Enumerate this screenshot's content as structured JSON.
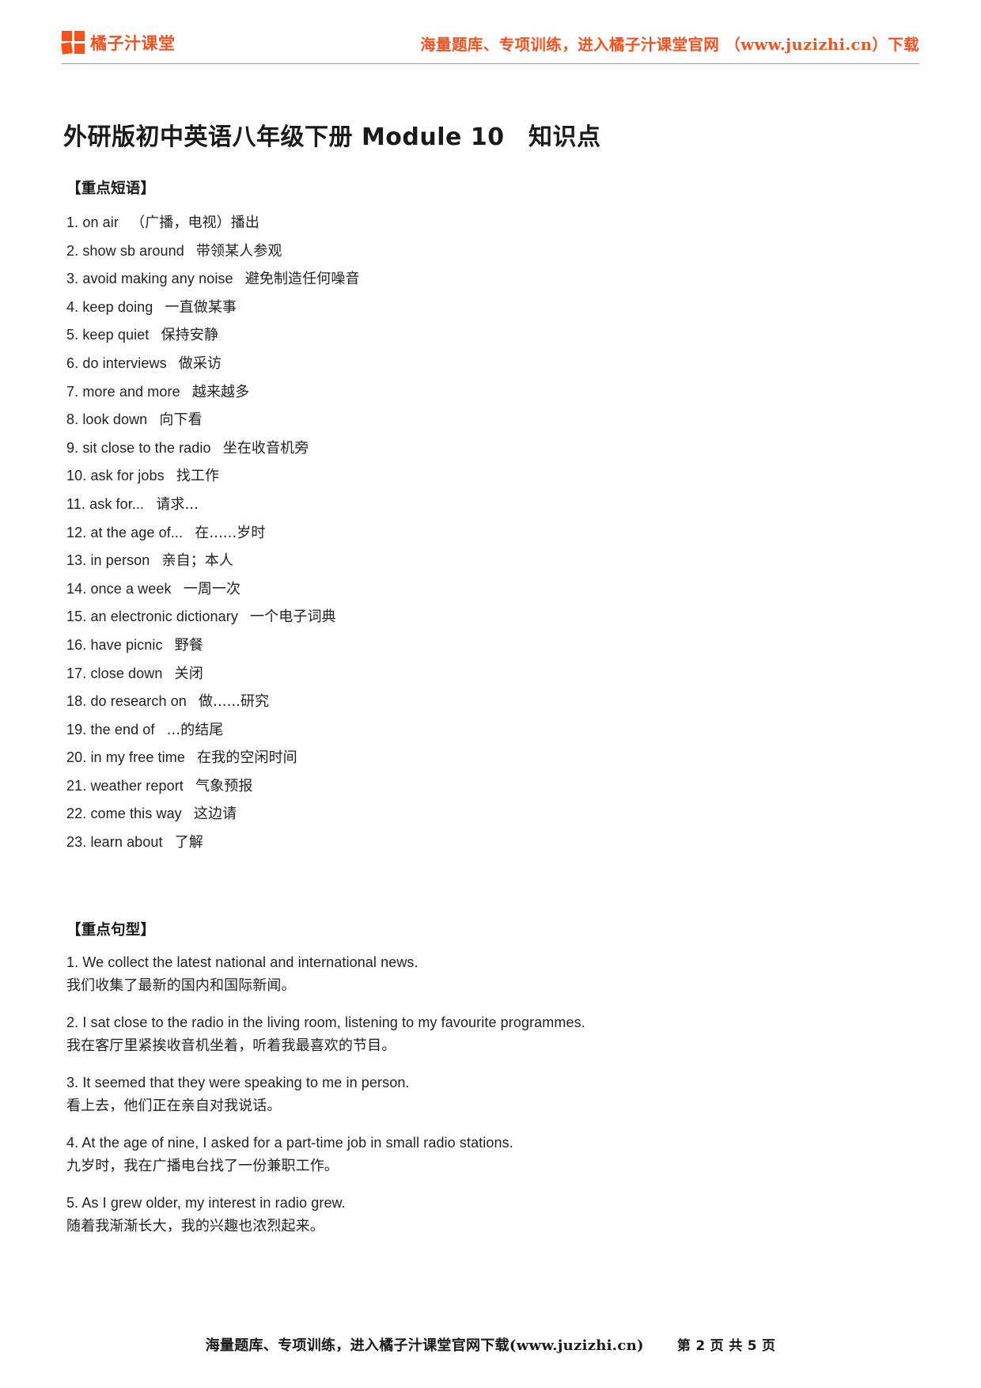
{
  "header": {
    "brand_name": "橘子汁课堂",
    "brand_color": "#f4511e",
    "promo": "海量题库、专项训练，进入橘子汁课堂官网 （www.juzizhi.cn）下载"
  },
  "title": "外研版初中英语八年级下册 Module 10　知识点",
  "phrases_section": {
    "heading": "【重点短语】",
    "items": [
      {
        "num": "1.",
        "en": "on air",
        "cn": "（广播，电视）播出"
      },
      {
        "num": "2.",
        "en": "show sb around",
        "cn": "带领某人参观"
      },
      {
        "num": "3.",
        "en": "avoid making any noise",
        "cn": "避免制造任何噪音"
      },
      {
        "num": "4.",
        "en": "keep doing",
        "cn": "一直做某事"
      },
      {
        "num": "5.",
        "en": "keep quiet",
        "cn": "保持安静"
      },
      {
        "num": "6.",
        "en": "do interviews",
        "cn": "做采访"
      },
      {
        "num": "7.",
        "en": "more and more",
        "cn": "越来越多"
      },
      {
        "num": "8.",
        "en": "look down",
        "cn": "向下看"
      },
      {
        "num": "9.",
        "en": "sit close to the radio",
        "cn": "坐在收音机旁"
      },
      {
        "num": "10.",
        "en": "ask for jobs",
        "cn": "找工作"
      },
      {
        "num": "11.",
        "en": "ask for...",
        "cn": "请求..."
      },
      {
        "num": "12.",
        "en": "at the age of...",
        "cn": "在......岁时"
      },
      {
        "num": "13.",
        "en": "in person",
        "cn": "亲自；本人"
      },
      {
        "num": "14.",
        "en": "once a week",
        "cn": "一周一次"
      },
      {
        "num": "15.",
        "en": "an electronic dictionary",
        "cn": "一个电子词典"
      },
      {
        "num": "16.",
        "en": "have picnic",
        "cn": "野餐"
      },
      {
        "num": "17.",
        "en": "close down",
        "cn": "关闭"
      },
      {
        "num": "18.",
        "en": "do research on",
        "cn": "做......研究"
      },
      {
        "num": "19.",
        "en": "the end of",
        "cn": "...的结尾"
      },
      {
        "num": "20.",
        "en": "in my free time",
        "cn": "在我的空闲时间"
      },
      {
        "num": "21.",
        "en": "weather report",
        "cn": "气象预报"
      },
      {
        "num": "22.",
        "en": "come this way",
        "cn": "这边请"
      },
      {
        "num": "23.",
        "en": "learn about",
        "cn": "了解"
      }
    ]
  },
  "sentences_section": {
    "heading": "【重点句型】",
    "items": [
      {
        "en": "1. We collect the latest national and international news.",
        "cn": "我们收集了最新的国内和国际新闻。"
      },
      {
        "en": "2. I sat close to the radio in the living room, listening to my favourite programmes.",
        "cn": "我在客厅里紧挨收音机坐着，听着我最喜欢的节目。"
      },
      {
        "en": "3. It seemed that they were speaking to me in person.",
        "cn": "看上去，他们正在亲自对我说话。"
      },
      {
        "en": "4. At the age of nine, I asked for a part-time job in small radio stations.",
        "cn": "九岁时，我在广播电台找了一份兼职工作。"
      },
      {
        "en": "5. As I grew older, my interest in radio grew.",
        "cn": "随着我渐渐长大，我的兴趣也浓烈起来。"
      }
    ]
  },
  "footer": {
    "promo": "海量题库、专项训练，进入橘子汁课堂官网下载(www.juzizhi.cn)",
    "pager": "第 2 页 共 5 页"
  }
}
